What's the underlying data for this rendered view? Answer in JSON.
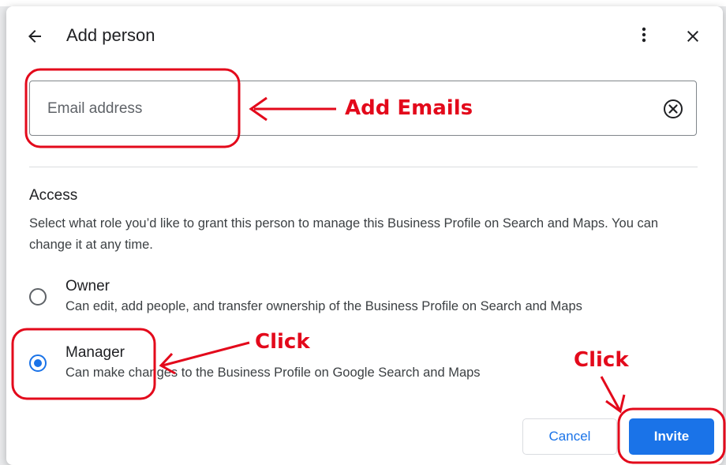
{
  "dialog": {
    "title": "Add person",
    "back_icon": "arrow-left-icon",
    "more_icon": "more-vert-icon",
    "close_icon": "close-icon"
  },
  "email": {
    "placeholder": "Email address",
    "value": "",
    "clear_icon": "cancel-circle-icon"
  },
  "access": {
    "heading": "Access",
    "description": "Select what role you’d like to grant this person to manage this Business Profile on Search and Maps. You can change it at any time.",
    "options": [
      {
        "title": "Owner",
        "description": "Can edit, add people, and transfer ownership of the Business Profile on Search and Maps",
        "selected": false
      },
      {
        "title": "Manager",
        "description": "Can make changes to the Business Profile on Google Search and Maps",
        "selected": true
      }
    ]
  },
  "actions": {
    "cancel_label": "Cancel",
    "invite_label": "Invite"
  },
  "annotations": {
    "add_emails": "Add Emails",
    "click_manager": "Click",
    "click_invite": "Click"
  },
  "colors": {
    "accent": "#1a73e8",
    "annotation": "#e3091b"
  }
}
